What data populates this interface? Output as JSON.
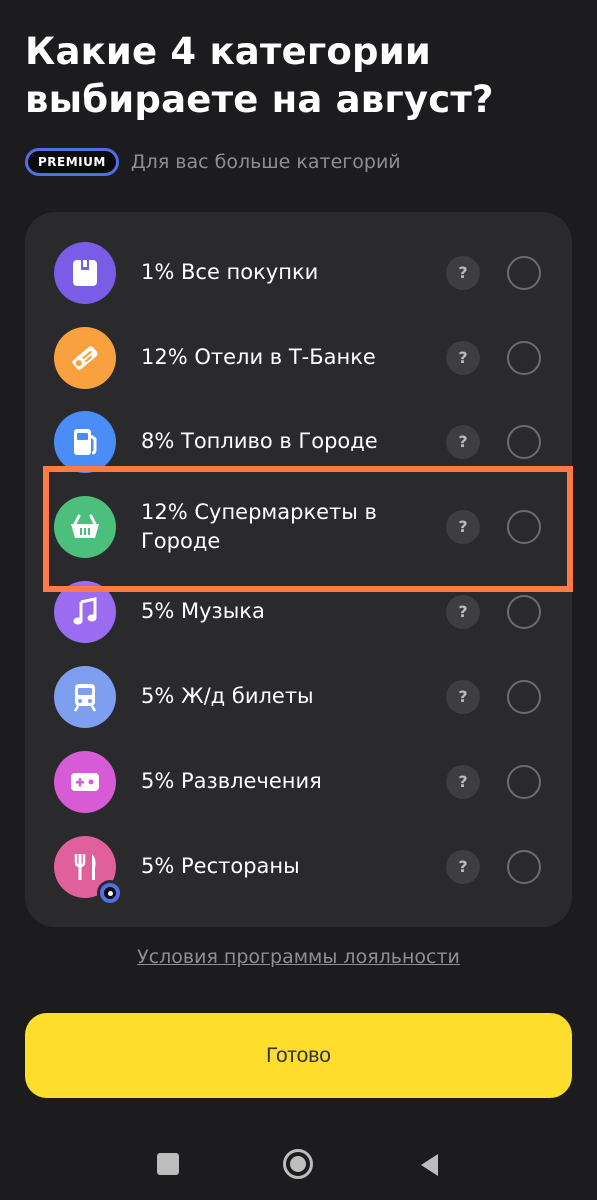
{
  "header": {
    "title_line1": "Какие 4 категории",
    "title_line2": "выбираете на август?"
  },
  "premium": {
    "badge": "PREMIUM",
    "text": "Для вас больше категорий"
  },
  "categories": [
    {
      "label": "1% Все покупки",
      "icon": "shopping-bag-icon",
      "color": "#7b5ce6"
    },
    {
      "label": "12% Отели в Т-Банке",
      "icon": "hotel-tag-icon",
      "color": "#f9a03f"
    },
    {
      "label": "8% Топливо в Городе",
      "icon": "fuel-pump-icon",
      "color": "#4a8df7"
    },
    {
      "label": "12% Супермаркеты в Городе",
      "icon": "basket-icon",
      "color": "#4cbf7d"
    },
    {
      "label": "5% Музыка",
      "icon": "music-note-icon",
      "color": "#9b6cf0"
    },
    {
      "label": "5% Ж/д билеты",
      "icon": "train-icon",
      "color": "#7e9ef0"
    },
    {
      "label": "5% Развлечения",
      "icon": "gamepad-icon",
      "color": "#d85bd6"
    },
    {
      "label": "5% Рестораны",
      "icon": "fork-knife-icon",
      "color": "#e0609c"
    }
  ],
  "help_symbol": "?",
  "loyalty_link": "Условия программы лояльности",
  "done_button": "Готово",
  "colors": {
    "accent": "#ffdd2d",
    "highlight": "#ff7a45",
    "premium_border": "#4f6fe8"
  }
}
